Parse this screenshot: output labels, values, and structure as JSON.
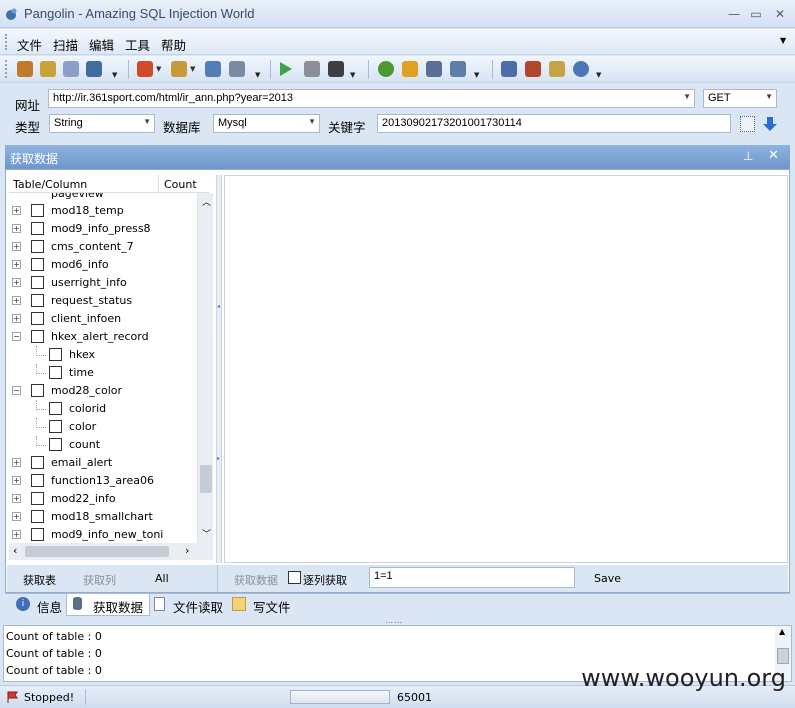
{
  "window": {
    "title": "Pangolin - Amazing SQL Injection World"
  },
  "menu": [
    "文件",
    "扫描",
    "编辑",
    "工具",
    "帮助"
  ],
  "toolbar": {
    "icons": [
      "search-icon",
      "open-icon",
      "document-icon",
      "save-icon",
      "gift-icon",
      "plugin-icon",
      "wrench-icon",
      "database-icon",
      "play-icon",
      "pause-icon",
      "stop-icon",
      "help-icon",
      "key-icon",
      "users-icon",
      "magnifier-icon",
      "home-icon",
      "bug-icon",
      "package-icon",
      "info-icon"
    ],
    "colors": [
      "#c07a2a",
      "#c9a23a",
      "#8aa0c8",
      "#3f6e9a",
      "#d24a2a",
      "#c89b3a",
      "#4f7fb5",
      "#7a8aa3",
      "#3ca24a",
      "#8a8f99",
      "#3c3f46",
      "#4c9a2f",
      "#e0a020",
      "#5a6f95",
      "#5b7fa8",
      "#4d6da8",
      "#b2462a",
      "#c6a445",
      "#4b77b8"
    ]
  },
  "url_panel": {
    "url_label": "网址",
    "url_value": "http://ir.361sport.com/html/ir_ann.php?year=2013",
    "method": "GET",
    "type_label": "类型",
    "type_value": "String",
    "db_label": "数据库",
    "db_value": "Mysql",
    "keyword_label": "关键字",
    "keyword_value": "20130902173201001730114"
  },
  "data_panel": {
    "title": "获取数据",
    "tree_header": {
      "name": "Table/Column",
      "count": "Count"
    },
    "partial_row": "pageview",
    "tree": [
      {
        "label": "mod18_temp",
        "level": 0,
        "expander": "+"
      },
      {
        "label": "mod9_info_press8",
        "level": 0,
        "expander": "+"
      },
      {
        "label": "cms_content_7",
        "level": 0,
        "expander": "+"
      },
      {
        "label": "mod6_info",
        "level": 0,
        "expander": "+"
      },
      {
        "label": "userright_info",
        "level": 0,
        "expander": "+"
      },
      {
        "label": "request_status",
        "level": 0,
        "expander": "+"
      },
      {
        "label": "client_infoen",
        "level": 0,
        "expander": "+"
      },
      {
        "label": "hkex_alert_record",
        "level": 0,
        "expander": "-"
      },
      {
        "label": "hkex",
        "level": 1,
        "expander": ""
      },
      {
        "label": "time",
        "level": 1,
        "expander": ""
      },
      {
        "label": "mod28_color",
        "level": 0,
        "expander": "-"
      },
      {
        "label": "colorid",
        "level": 1,
        "expander": ""
      },
      {
        "label": "color",
        "level": 1,
        "expander": ""
      },
      {
        "label": "count",
        "level": 1,
        "expander": ""
      },
      {
        "label": "email_alert",
        "level": 0,
        "expander": "+"
      },
      {
        "label": "function13_area06",
        "level": 0,
        "expander": "+"
      },
      {
        "label": "mod22_info",
        "level": 0,
        "expander": "+"
      },
      {
        "label": "mod18_smallchart",
        "level": 0,
        "expander": "+"
      },
      {
        "label": "mod9_info_new_toni",
        "level": 0,
        "expander": "+"
      }
    ],
    "left_buttons": [
      "获取表",
      "获取列",
      "All"
    ],
    "get_data": "获取数据",
    "column_by_column": "逐列获取",
    "condition_value": "1=1",
    "save": "Save"
  },
  "tabs": [
    "信息",
    "获取数据",
    "文件读取",
    "写文件"
  ],
  "output_lines": [
    "Count of table : 0",
    "Count of table : 0",
    "Count of table : 0"
  ],
  "status": {
    "text": "Stopped!",
    "number": "65001"
  },
  "watermark": "www.wooyun.org"
}
